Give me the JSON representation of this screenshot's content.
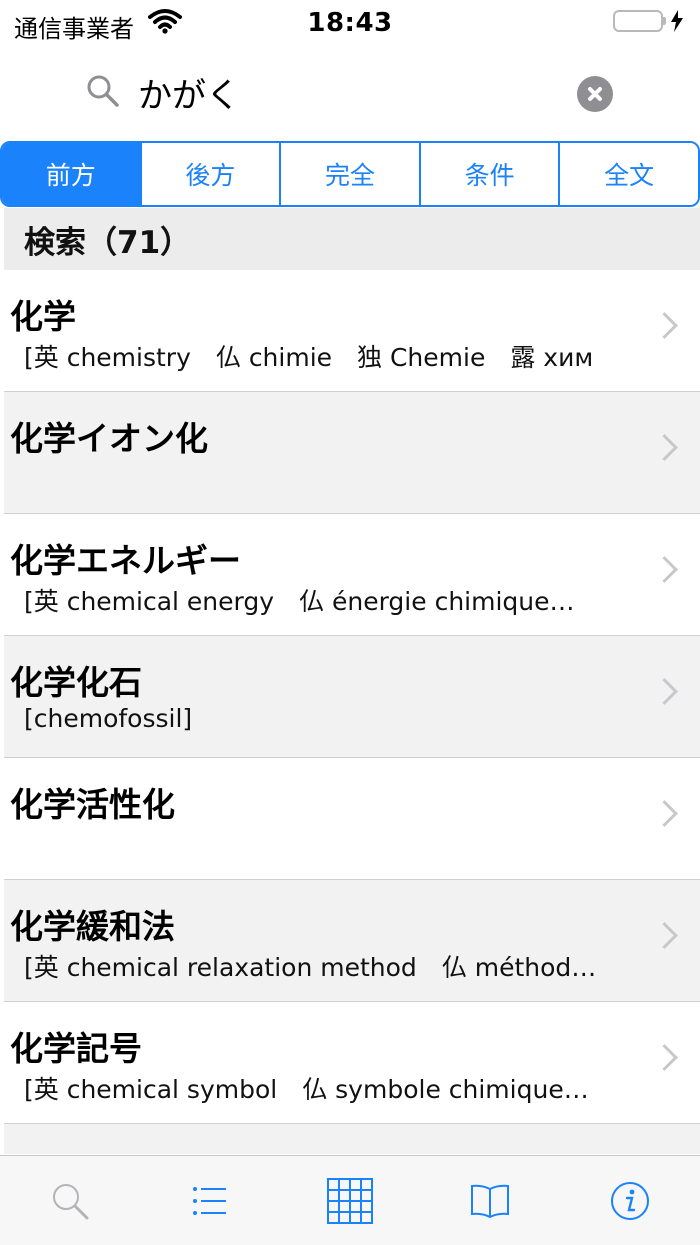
{
  "status_bar": {
    "carrier": "通信事業者",
    "time": "18:43"
  },
  "search": {
    "query": "かがく",
    "icon": "search-icon",
    "clear_icon": "clear-icon"
  },
  "segments": [
    {
      "label": "前方",
      "selected": true
    },
    {
      "label": "後方",
      "selected": false
    },
    {
      "label": "完全",
      "selected": false
    },
    {
      "label": "条件",
      "selected": false
    },
    {
      "label": "全文",
      "selected": false
    }
  ],
  "section": {
    "title": "検索（71）"
  },
  "results": [
    {
      "title": "化学",
      "subtitle": "[英 chemistry　仏 chimie　独 Chemie　露 хим"
    },
    {
      "title": "化学イオン化",
      "subtitle": ""
    },
    {
      "title": "化学エネルギー",
      "subtitle": "[英 chemical energy　仏 énergie chimique…"
    },
    {
      "title": "化学化石",
      "subtitle": "[chemofossil]"
    },
    {
      "title": "化学活性化",
      "subtitle": ""
    },
    {
      "title": "化学緩和法",
      "subtitle": "[英 chemical relaxation method　仏 méthod…"
    },
    {
      "title": "化学記号",
      "subtitle": "[英 chemical symbol　仏 symbole chimique…"
    }
  ],
  "tab_bar": {
    "items": [
      "search-icon",
      "list-icon",
      "grid-icon",
      "book-icon",
      "info-icon"
    ]
  },
  "colors": {
    "accent": "#1a82fb",
    "battery": "#4cd964",
    "section_bg": "#ececec",
    "alt_row_bg": "#f2f2f2"
  }
}
